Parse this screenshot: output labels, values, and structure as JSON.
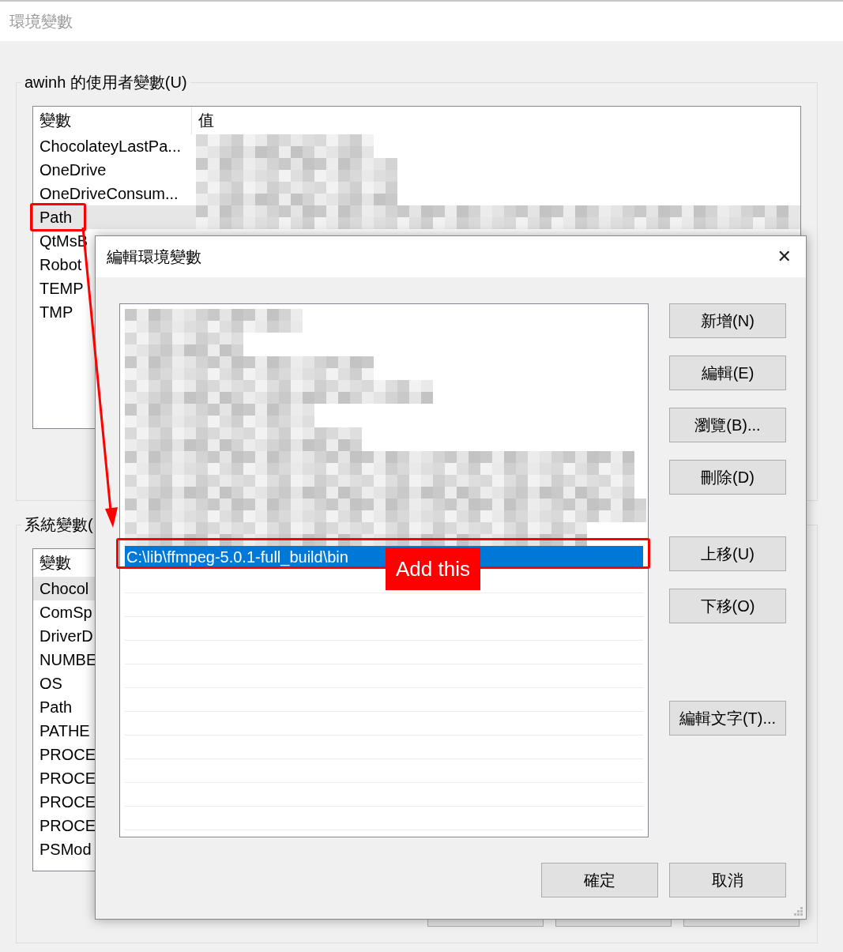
{
  "window": {
    "title": "環境變數"
  },
  "user_variables": {
    "title": "awinh 的使用者變數(U)",
    "columns": [
      "變數",
      "值"
    ],
    "rows": [
      {
        "name": "ChocolateyLastPa...",
        "kind": "pixelated",
        "selected": false
      },
      {
        "name": "OneDrive",
        "kind": "pixelated",
        "selected": false
      },
      {
        "name": "OneDriveConsum...",
        "kind": "pixelated",
        "selected": false
      },
      {
        "name": "Path",
        "kind": "pixelated",
        "selected": true
      },
      {
        "name": "QtMsB",
        "kind": "plain",
        "selected": false
      },
      {
        "name": "Robot",
        "kind": "plain",
        "selected": false
      },
      {
        "name": "TEMP",
        "kind": "plain",
        "selected": false
      },
      {
        "name": "TMP",
        "kind": "plain",
        "selected": false
      }
    ]
  },
  "system_variables": {
    "title": "系統變數(",
    "columns": [
      "變數"
    ],
    "rows": [
      {
        "name": "Chocol",
        "selected": true
      },
      {
        "name": "ComSp",
        "selected": false
      },
      {
        "name": "DriverD",
        "selected": false
      },
      {
        "name": "NUMBE",
        "selected": false
      },
      {
        "name": "OS",
        "selected": false
      },
      {
        "name": "Path",
        "selected": false
      },
      {
        "name": "PATHE",
        "selected": false
      },
      {
        "name": "PROCE",
        "selected": false
      },
      {
        "name": "PROCE",
        "selected": false
      },
      {
        "name": "PROCE",
        "selected": false
      },
      {
        "name": "PROCE",
        "selected": false
      },
      {
        "name": "PSMod",
        "selected": false
      }
    ]
  },
  "dialog": {
    "title": "編輯環境變數",
    "close": "✕",
    "entries": [
      {
        "kind": "pixelated",
        "selected": false
      },
      {
        "kind": "pixelated",
        "selected": false
      },
      {
        "kind": "pixelated",
        "selected": false
      },
      {
        "kind": "pixelated",
        "selected": false
      },
      {
        "kind": "pixelated",
        "selected": false
      },
      {
        "kind": "pixelated",
        "selected": false
      },
      {
        "kind": "pixelated",
        "selected": false
      },
      {
        "kind": "pixelated",
        "selected": false
      },
      {
        "kind": "pixelated",
        "selected": false
      },
      {
        "kind": "pixelated",
        "selected": false
      },
      {
        "kind": "text",
        "text": "C:\\lib\\ffmpeg-5.0.1-full_build\\bin",
        "selected": true
      }
    ],
    "side_buttons": [
      "新增(N)",
      "編輯(E)",
      "瀏覽(B)...",
      "刪除(D)",
      "上移(U)",
      "下移(O)",
      "編輯文字(T)..."
    ],
    "buttons": [
      "確定",
      "取消"
    ]
  },
  "annotation": {
    "label": "Add this"
  }
}
